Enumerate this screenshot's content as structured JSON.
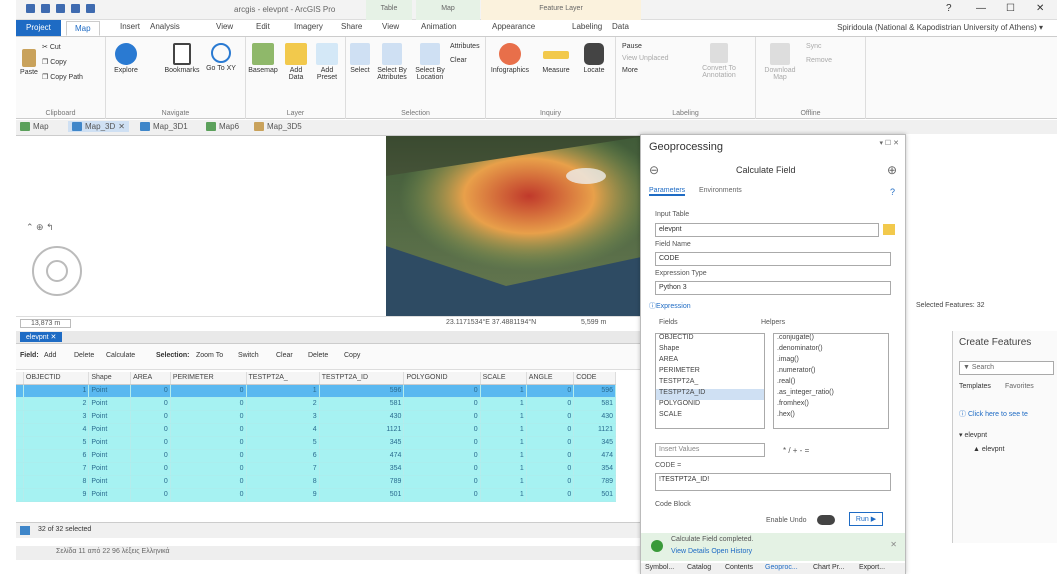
{
  "window": {
    "title": "arcgis - elevpnt - ArcGIS Pro",
    "context_tabs": [
      "Table",
      "Map",
      "Feature Layer"
    ],
    "context_tab_sub": [
      "View",
      "Animation",
      "Appearance",
      "Labeling",
      "Data"
    ],
    "help": "?",
    "min": "—",
    "max": "☐",
    "close": "✕"
  },
  "ribbon_tabs": [
    "Project",
    "Map",
    "Insert",
    "Analysis",
    "View",
    "Edit",
    "Imagery",
    "Share"
  ],
  "user": "Spiridoula (National & Kapodistrian University of Athens) ▾",
  "ribbon": {
    "clipboard": {
      "label": "Clipboard",
      "cut": "Cut",
      "copy": "Copy",
      "paste": "Paste",
      "copy_path": "Copy Path"
    },
    "navigate": {
      "label": "Navigate",
      "explore": "Explore",
      "bookmarks": "Bookmarks",
      "goto": "Go To XY"
    },
    "layer": {
      "label": "Layer",
      "basemap": "Basemap",
      "add_data": "Add Data",
      "add_preset": "Add Preset"
    },
    "selection": {
      "label": "Selection",
      "select": "Select",
      "by_attr": "Select By Attributes",
      "by_loc": "Select By Location",
      "attributes": "Attributes",
      "clear": "Clear"
    },
    "inquiry": {
      "label": "Inquiry",
      "infographics": "Infographics",
      "measure": "Measure",
      "locate": "Locate"
    },
    "labeling": {
      "label": "Labeling",
      "pause": "Pause",
      "view_unplaced": "View Unplaced",
      "more": "More",
      "convert": "Convert To Annotation"
    },
    "offline": {
      "label": "Offline",
      "download": "Download Map",
      "sync": "Sync",
      "remove": "Remove"
    }
  },
  "view_tabs": [
    "Map",
    "Map_3D",
    "Map_3D1",
    "Map6",
    "Map_3D5"
  ],
  "map": {
    "scale": "13,873 m",
    "coords": "23.1171534°E 37.4881194°N",
    "elev": "5,599 m",
    "selected": "Selected Features: 32"
  },
  "table": {
    "tab": "elevpnt",
    "field_label": "Field:",
    "field_tools": [
      "Add",
      "Delete",
      "Calculate"
    ],
    "selection_label": "Selection:",
    "selection_tools": [
      "Zoom To",
      "Switch",
      "Clear",
      "Delete",
      "Copy"
    ],
    "columns": [
      "OBJECTID",
      "Shape",
      "AREA",
      "PERIMETER",
      "TESTPT2A_",
      "TESTPT2A_ID",
      "POLYGONID",
      "SCALE",
      "ANGLE",
      "CODE"
    ],
    "rows": [
      [
        "1",
        "Point",
        "0",
        "0",
        "1",
        "596",
        "0",
        "1",
        "0",
        "596"
      ],
      [
        "2",
        "Point",
        "0",
        "0",
        "2",
        "581",
        "0",
        "1",
        "0",
        "581"
      ],
      [
        "3",
        "Point",
        "0",
        "0",
        "3",
        "430",
        "0",
        "1",
        "0",
        "430"
      ],
      [
        "4",
        "Point",
        "0",
        "0",
        "4",
        "1121",
        "0",
        "1",
        "0",
        "1121"
      ],
      [
        "5",
        "Point",
        "0",
        "0",
        "5",
        "345",
        "0",
        "1",
        "0",
        "345"
      ],
      [
        "6",
        "Point",
        "0",
        "0",
        "6",
        "474",
        "0",
        "1",
        "0",
        "474"
      ],
      [
        "7",
        "Point",
        "0",
        "0",
        "7",
        "354",
        "0",
        "1",
        "0",
        "354"
      ],
      [
        "8",
        "Point",
        "0",
        "0",
        "8",
        "789",
        "0",
        "1",
        "0",
        "789"
      ],
      [
        "9",
        "Point",
        "0",
        "0",
        "9",
        "501",
        "0",
        "1",
        "0",
        "501"
      ]
    ],
    "footer": "32 of 32 selected",
    "taskbar": "Σελίδα 11 από 22   96 λέξεις   Ελληνικά"
  },
  "geoprocessing": {
    "panel_title": "Geoprocessing",
    "tool_title": "Calculate Field",
    "tabs": [
      "Parameters",
      "Environments"
    ],
    "input_table_label": "Input Table",
    "input_table": "elevpnt",
    "field_name_label": "Field Name",
    "field_name": "CODE",
    "expr_type_label": "Expression Type",
    "expr_type": "Python 3",
    "expression_label": "Expression",
    "fields_label": "Fields",
    "helpers_label": "Helpers",
    "fields": [
      "OBJECTID",
      "Shape",
      "AREA",
      "PERIMETER",
      "TESTPT2A_",
      "TESTPT2A_ID",
      "POLYGONID",
      "SCALE"
    ],
    "helpers": [
      ".conjugate()",
      ".denominator()",
      ".imag()",
      ".numerator()",
      ".real()",
      ".as_integer_ratio()",
      ".fromhex()",
      ".hex()"
    ],
    "insert_values": "Insert Values",
    "operators": "*  /  +  -  =",
    "expr_prefix": "CODE =",
    "expression": "!TESTPT2A_ID!",
    "code_block": "Code Block",
    "enable_undo": "Enable Undo",
    "run": "Run",
    "message": "Calculate Field completed.",
    "message_links": "View Details   Open History",
    "bottom_tabs": [
      "Symbol...",
      "Catalog",
      "Contents",
      "Geoproc...",
      "Chart Pr...",
      "Export..."
    ]
  },
  "create_features": {
    "title": "Create Features",
    "search": "Search",
    "tabs": [
      "Templates",
      "Favorites"
    ],
    "hint": "Click here to see te",
    "layer": "elevpnt",
    "item": "elevpnt"
  }
}
